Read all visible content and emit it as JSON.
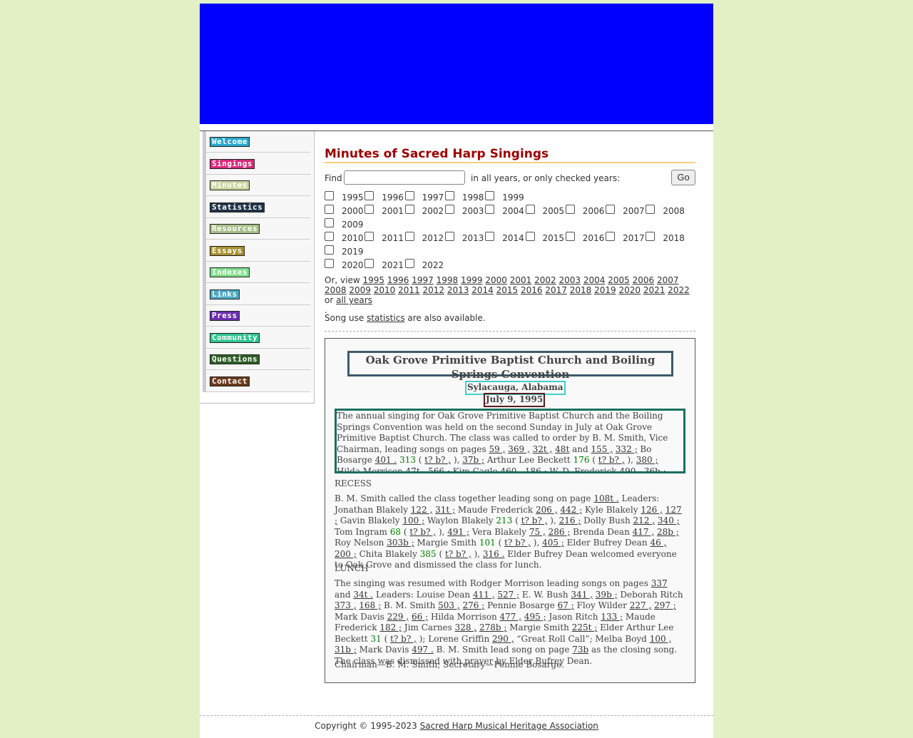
{
  "nav": [
    {
      "label": "Welcome",
      "color": "#2aa7c9"
    },
    {
      "label": "Singings",
      "color": "#d62b7a"
    },
    {
      "label": "Minutes",
      "color": "#c8d6a0"
    },
    {
      "label": "Statistics",
      "color": "#1f3347"
    },
    {
      "label": "Resources",
      "color": "#a8c08a"
    },
    {
      "label": "Essays",
      "color": "#a5902b"
    },
    {
      "label": "Indexes",
      "color": "#7ee08a"
    },
    {
      "label": "Links",
      "color": "#4aa8c8"
    },
    {
      "label": "Press",
      "color": "#6a2fb0"
    },
    {
      "label": "Community",
      "color": "#2ec48f"
    },
    {
      "label": "Questions",
      "color": "#2e5e28"
    },
    {
      "label": "Contact",
      "color": "#6b3a1c"
    }
  ],
  "main": {
    "title": "Minutes of Sacred Harp Singings",
    "find_label": "Find",
    "find_value": "",
    "find_suffix": "in all years, or only checked years:",
    "go_label": "Go",
    "years": [
      "1995",
      "1996",
      "1997",
      "1998",
      "1999",
      "2000",
      "2001",
      "2002",
      "2003",
      "2004",
      "2005",
      "2006",
      "2007",
      "2008",
      "2009",
      "2010",
      "2011",
      "2012",
      "2013",
      "2014",
      "2015",
      "2016",
      "2017",
      "2018",
      "2019",
      "2020",
      "2021",
      "2022"
    ],
    "view_prefix": "Or, view",
    "view_or": "or",
    "view_all": "all years",
    "view_end": ".",
    "stats_prefix": "Song use",
    "stats_link": "statistics",
    "stats_suffix": "are also available."
  },
  "minutes": {
    "title": "Oak Grove Primitive Baptist Church and Boiling Springs Convention",
    "location": "Sylacauga, Alabama",
    "date": "July 9, 1995",
    "recess": "RECESS",
    "lunch": "LUNCH",
    "officers": "Chairman—B. M. Smith; Secretary—Pennie Bosarge."
  },
  "footer": {
    "copyright": "Copyright © 1995-2023",
    "org": "Sacred Harp Musical Heritage Association"
  }
}
